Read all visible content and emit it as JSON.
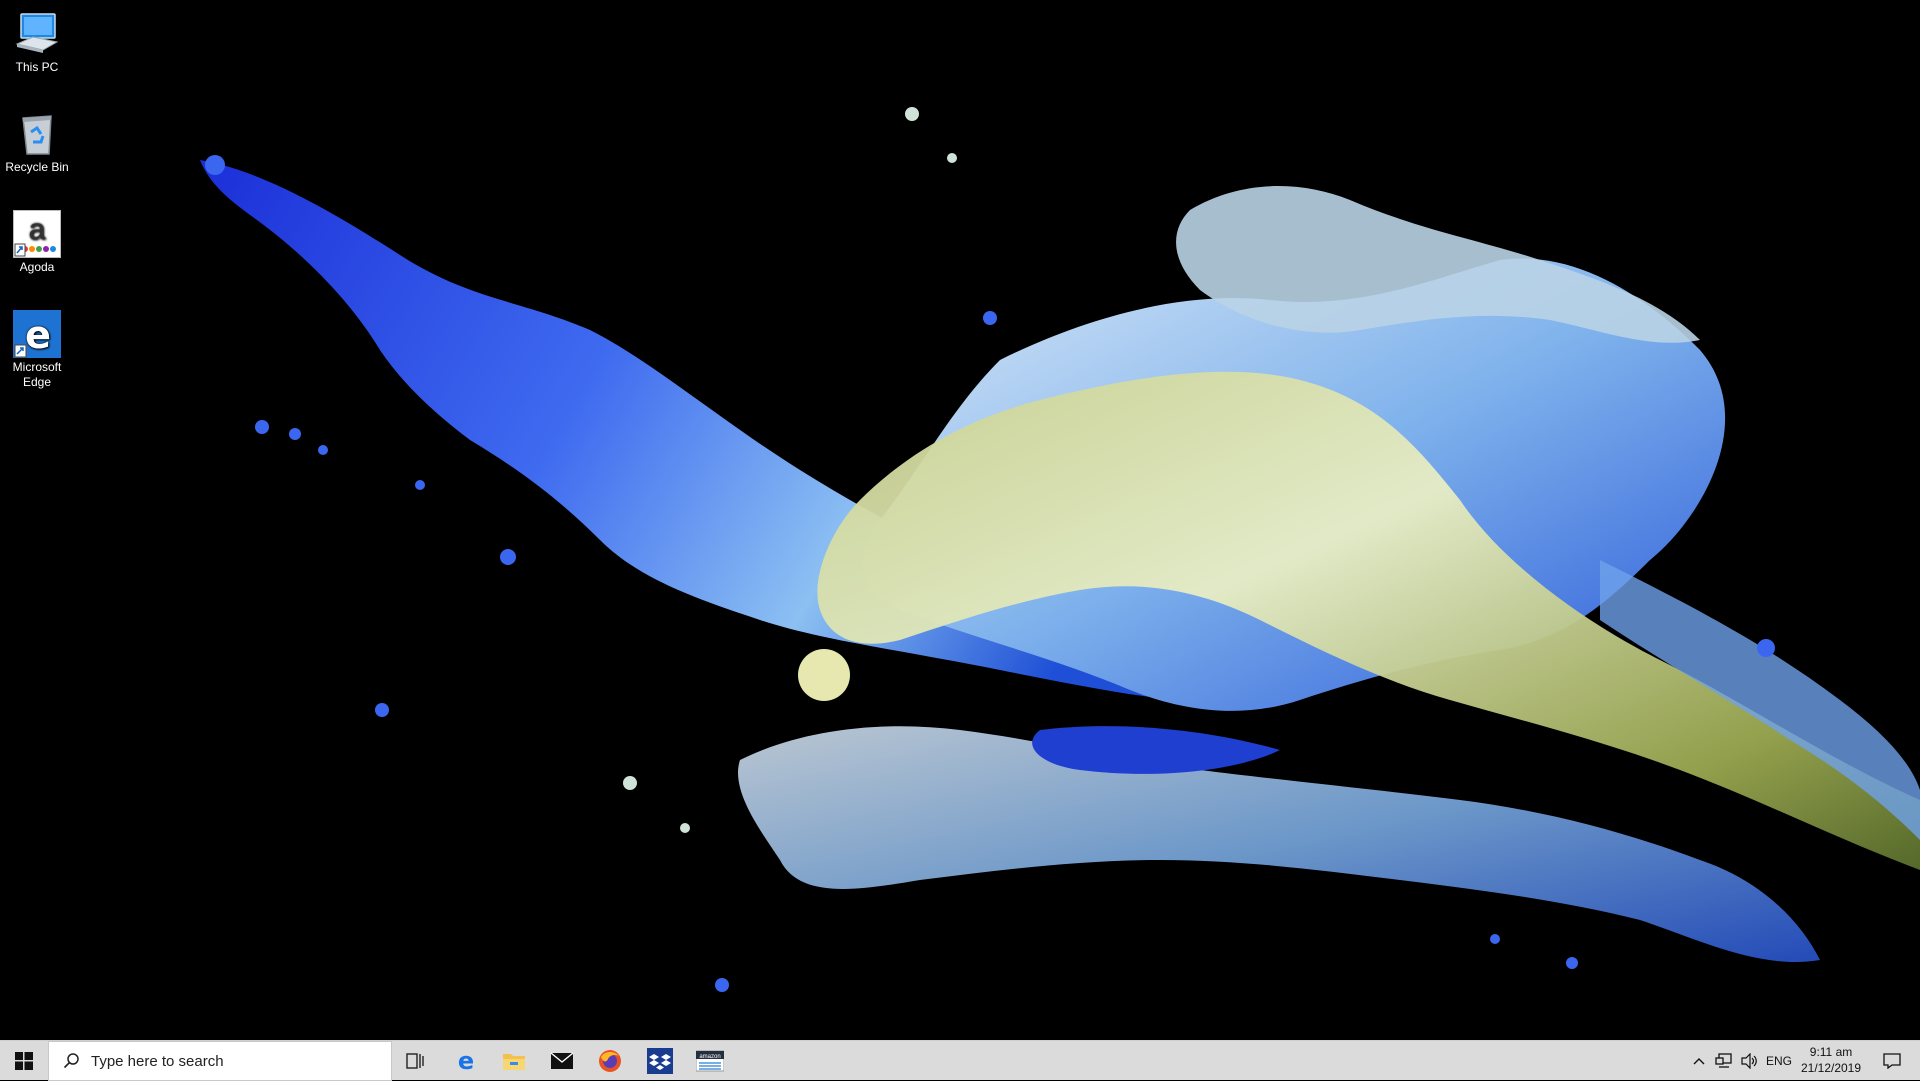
{
  "desktop": {
    "icons": [
      {
        "label": "This PC",
        "icon": "this-pc-icon"
      },
      {
        "label": "Recycle Bin",
        "icon": "recycle-bin-icon"
      },
      {
        "label": "Agoda",
        "icon": "agoda-icon"
      },
      {
        "label": "Microsoft Edge",
        "icon": "edge-icon"
      }
    ]
  },
  "taskbar": {
    "search_placeholder": "Type here to search",
    "pinned": [
      "task-view-icon",
      "edge-icon",
      "file-explorer-icon",
      "mail-icon",
      "firefox-icon",
      "dropbox-icon",
      "amazon-icon"
    ],
    "tray": {
      "language": "ENG",
      "time": "9:11 am",
      "date": "21/12/2019"
    }
  },
  "colors": {
    "taskbar_bg": "#dbdbdb",
    "accent_blue": "#1a73e8"
  }
}
